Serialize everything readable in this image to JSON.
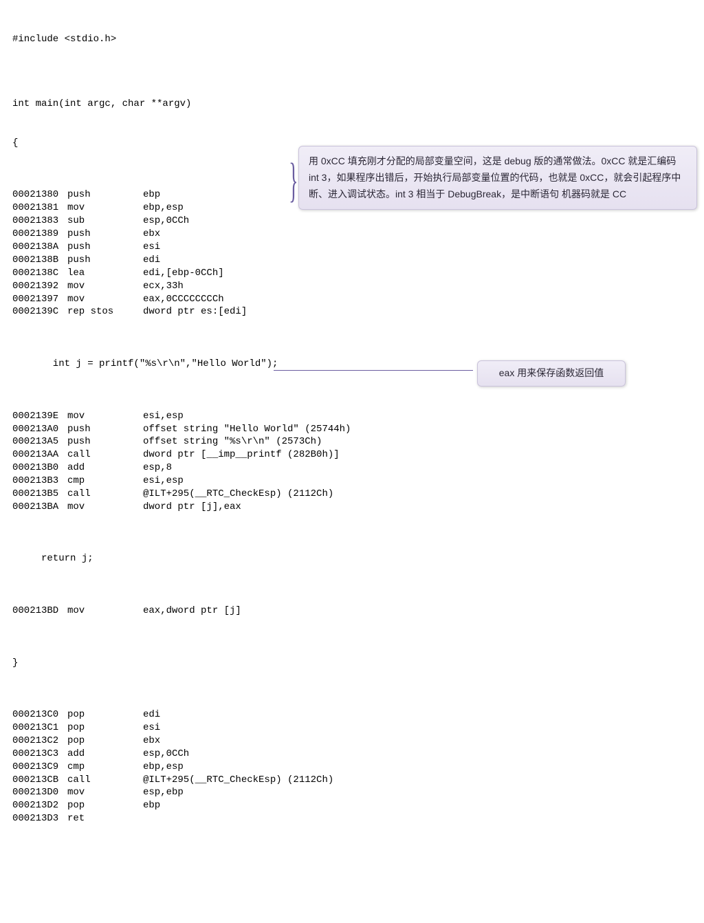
{
  "source": {
    "include": "#include <stdio.h>",
    "blank1": "",
    "main_sig": "int main(int argc, char **argv)",
    "brace_open": "{",
    "asm_block1": [
      {
        "addr": "00021380",
        "mnem": "push",
        "opnd": "ebp"
      },
      {
        "addr": "00021381",
        "mnem": "mov",
        "opnd": "ebp,esp"
      },
      {
        "addr": "00021383",
        "mnem": "sub",
        "opnd": "esp,0CCh"
      },
      {
        "addr": "00021389",
        "mnem": "push",
        "opnd": "ebx"
      },
      {
        "addr": "0002138A",
        "mnem": "push",
        "opnd": "esi"
      },
      {
        "addr": "0002138B",
        "mnem": "push",
        "opnd": "edi"
      },
      {
        "addr": "0002138C",
        "mnem": "lea",
        "opnd": "edi,[ebp-0CCh]"
      },
      {
        "addr": "00021392",
        "mnem": "mov",
        "opnd": "ecx,33h"
      },
      {
        "addr": "00021397",
        "mnem": "mov",
        "opnd": "eax,0CCCCCCCCh"
      },
      {
        "addr": "0002139C",
        "mnem": "rep stos",
        "opnd": "dword ptr es:[edi]"
      }
    ],
    "c_line1": "       int j = printf(\"%s\\r\\n\",\"Hello World\");",
    "asm_block2": [
      {
        "addr": "0002139E",
        "mnem": "mov",
        "opnd": "esi,esp"
      },
      {
        "addr": "000213A0",
        "mnem": "push",
        "opnd": "offset string \"Hello World\" (25744h)"
      },
      {
        "addr": "000213A5",
        "mnem": "push",
        "opnd": "offset string \"%s\\r\\n\" (2573Ch)"
      },
      {
        "addr": "000213AA",
        "mnem": "call",
        "opnd": "dword ptr [__imp__printf (282B0h)]"
      },
      {
        "addr": "000213B0",
        "mnem": "add",
        "opnd": "esp,8"
      },
      {
        "addr": "000213B3",
        "mnem": "cmp",
        "opnd": "esi,esp"
      },
      {
        "addr": "000213B5",
        "mnem": "call",
        "opnd": "@ILT+295(__RTC_CheckEsp) (2112Ch)"
      },
      {
        "addr": "000213BA",
        "mnem": "mov",
        "opnd": "dword ptr [j],eax"
      }
    ],
    "c_line2": "     return j;",
    "asm_block3": [
      {
        "addr": "000213BD",
        "mnem": "mov",
        "opnd": "eax,dword ptr [j]"
      }
    ],
    "brace_close": "}",
    "asm_block4": [
      {
        "addr": "000213C0",
        "mnem": "pop",
        "opnd": "edi"
      },
      {
        "addr": "000213C1",
        "mnem": "pop",
        "opnd": "esi"
      },
      {
        "addr": "000213C2",
        "mnem": "pop",
        "opnd": "ebx"
      },
      {
        "addr": "000213C3",
        "mnem": "add",
        "opnd": "esp,0CCh"
      },
      {
        "addr": "000213C9",
        "mnem": "cmp",
        "opnd": "ebp,esp"
      },
      {
        "addr": "000213CB",
        "mnem": "call",
        "opnd": "@ILT+295(__RTC_CheckEsp) (2112Ch)"
      },
      {
        "addr": "000213D0",
        "mnem": "mov",
        "opnd": "esp,ebp"
      },
      {
        "addr": "000213D2",
        "mnem": "pop",
        "opnd": "ebp"
      },
      {
        "addr": "000213D3",
        "mnem": "ret",
        "opnd": ""
      }
    ]
  },
  "callouts": {
    "c1": "用 0xCC 填充刚才分配的局部变量空间，这是 debug 版的通常做法。0xCC 就是汇编码 int 3，如果程序出错后，开始执行局部变量位置的代码，也就是 0xCC，就会引起程序中断、进入调试状态。int 3 相当于 DebugBreak，是中断语句 机器码就是 CC",
    "c2": "eax 用来保存函数返回值"
  }
}
